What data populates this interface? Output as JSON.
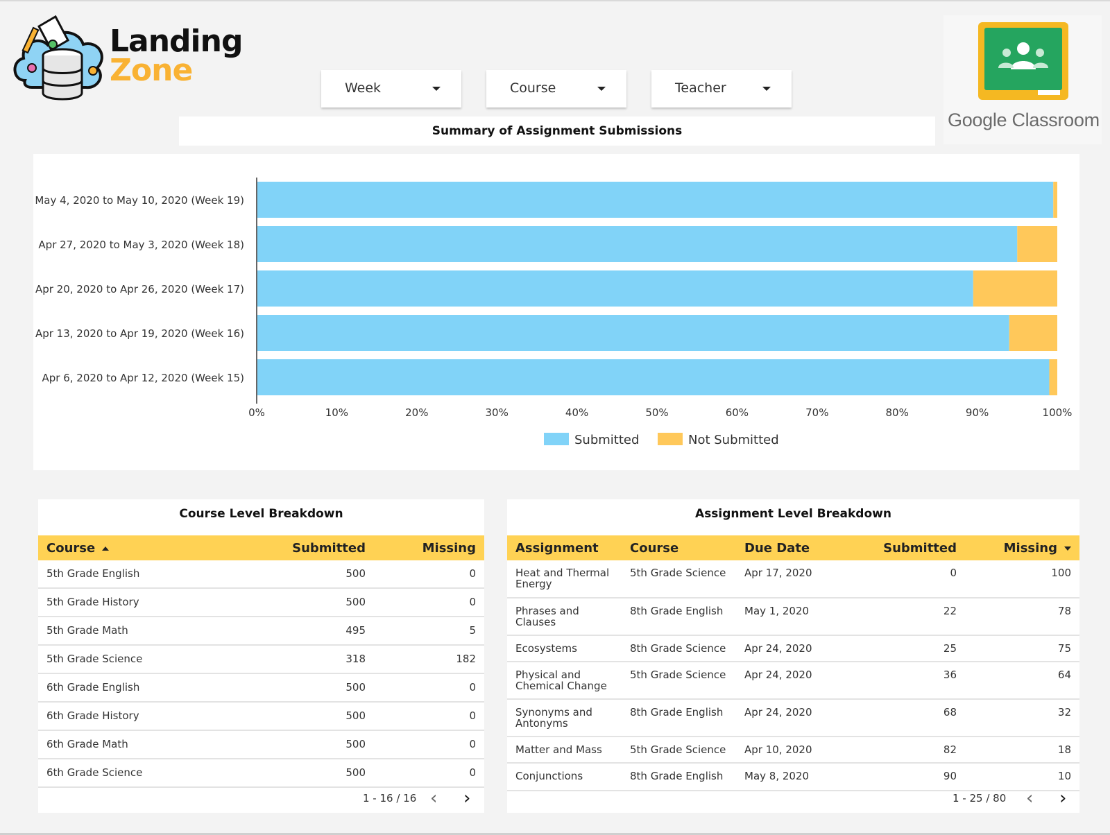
{
  "brand": {
    "line1": "Landing",
    "line2": "Zone"
  },
  "google_classroom": {
    "label": "Google Classroom"
  },
  "filters": [
    {
      "label": "Week"
    },
    {
      "label": "Course"
    },
    {
      "label": "Teacher"
    }
  ],
  "summary": {
    "title": "Summary of Assignment Submissions"
  },
  "chart_data": {
    "type": "bar",
    "orientation": "horizontal",
    "stacked": "percent",
    "categories": [
      "May 4, 2020 to May 10, 2020 (Week 19)",
      "Apr 27, 2020 to May 3, 2020 (Week 18)",
      "Apr 20, 2020 to Apr 26, 2020 (Week 17)",
      "Apr 13, 2020 to Apr 19, 2020 (Week 16)",
      "Apr 6, 2020 to Apr 12, 2020 (Week 15)"
    ],
    "series": [
      {
        "name": "Submitted",
        "color": "#81d3f8",
        "values": [
          99.5,
          95,
          89.5,
          94,
          99
        ]
      },
      {
        "name": "Not Submitted",
        "color": "#ffc85a",
        "values": [
          0.5,
          5,
          10.5,
          6,
          1
        ]
      }
    ],
    "xticks": [
      "0%",
      "10%",
      "20%",
      "30%",
      "40%",
      "50%",
      "60%",
      "70%",
      "80%",
      "90%",
      "100%"
    ],
    "xlim": [
      0,
      100
    ],
    "legend_position": "bottom",
    "grid": false
  },
  "course_breakdown": {
    "title": "Course Level Breakdown",
    "columns": [
      "Course",
      "Submitted",
      "Missing"
    ],
    "rows": [
      [
        "5th Grade English",
        "500",
        "0"
      ],
      [
        "5th Grade History",
        "500",
        "0"
      ],
      [
        "5th Grade Math",
        "495",
        "5"
      ],
      [
        "5th Grade Science",
        "318",
        "182"
      ],
      [
        "6th Grade English",
        "500",
        "0"
      ],
      [
        "6th Grade History",
        "500",
        "0"
      ],
      [
        "6th Grade Math",
        "500",
        "0"
      ],
      [
        "6th Grade Science",
        "500",
        "0"
      ]
    ],
    "pagination": "1 - 16 / 16"
  },
  "assignment_breakdown": {
    "title": "Assignment Level Breakdown",
    "columns": [
      "Assignment",
      "Course",
      "Due Date",
      "Submitted",
      "Missing"
    ],
    "rows": [
      [
        "Heat and Thermal Energy",
        "5th Grade Science",
        "Apr 17, 2020",
        "0",
        "100"
      ],
      [
        "Phrases and Clauses",
        "8th Grade English",
        "May 1, 2020",
        "22",
        "78"
      ],
      [
        "Ecosystems",
        "8th Grade Science",
        "Apr 24, 2020",
        "25",
        "75"
      ],
      [
        "Physical and Chemical Change",
        "5th Grade Science",
        "Apr 24, 2020",
        "36",
        "64"
      ],
      [
        "Synonyms and Antonyms",
        "8th Grade English",
        "Apr 24, 2020",
        "68",
        "32"
      ],
      [
        "Matter and Mass",
        "5th Grade Science",
        "Apr 10, 2020",
        "82",
        "18"
      ],
      [
        "Conjunctions",
        "8th Grade English",
        "May 8, 2020",
        "90",
        "10"
      ]
    ],
    "pagination": "1 - 25 / 80"
  }
}
